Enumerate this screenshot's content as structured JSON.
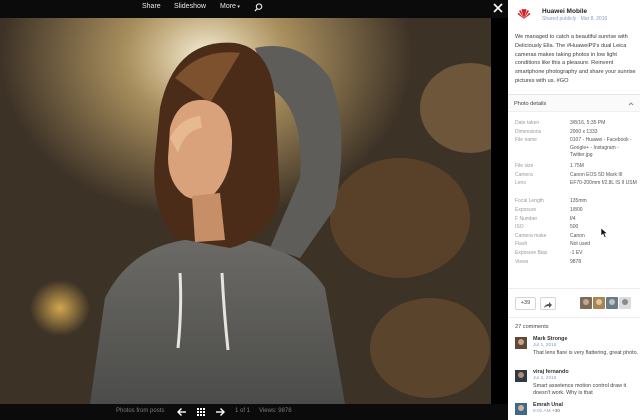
{
  "viewer": {
    "top_nav": [
      {
        "label": "Share"
      },
      {
        "label": "Slideshow"
      },
      {
        "label": "More"
      }
    ],
    "bottom": {
      "photos_from_posts": "Photos from posts",
      "page_indicator": "1 of 1",
      "views": "Views: 9878"
    }
  },
  "panel": {
    "author": "Huawei Mobile",
    "share_meta": "Shared publicly · Mar 8, 2016",
    "post_text": "We managed to catch a beautiful sunrise with Deliciously Ella. The #HuaweiP9's dual Leica cameras makes taking photos in low light conditions like this a pleasure. Reinvent smartphone photography and share your sunrise pictures with us. #GO",
    "details_title": "Photo details",
    "details": [
      {
        "label": "Date taken",
        "value": "3/8/16, 5:35 PM"
      },
      {
        "label": "Dimensions",
        "value": "2000 x 1333"
      },
      {
        "label": "File name",
        "value": "0107 - Huawei - Facebook - Google+ - Instagram - Twitter.jpg"
      },
      {
        "label": "File size",
        "value": "1.75M"
      },
      {
        "label": "Camera",
        "value": "Canon EOS 5D Mark III"
      },
      {
        "label": "Lens",
        "value": "EF70-200mm f/2.8L IS II USM"
      },
      {
        "label": "Focal Length",
        "value": "135mm"
      },
      {
        "label": "Exposure",
        "value": "1/800"
      },
      {
        "label": "F Number",
        "value": "f/4"
      },
      {
        "label": "ISO",
        "value": "500"
      },
      {
        "label": "Camera make",
        "value": "Canon"
      },
      {
        "label": "Flash",
        "value": "Not used"
      },
      {
        "label": "Exposure Bias",
        "value": "-1 EV"
      },
      {
        "label": "Views",
        "value": "9878"
      }
    ],
    "plus_count": "+39",
    "comments_count": "27 comments",
    "comments": [
      {
        "name": "Mark Stronge",
        "date": "Jul 1, 2016",
        "text": "That lens flare is very flattering, great photo."
      },
      {
        "name": "viraj fernando",
        "date": "Jul 2, 2016",
        "text": "Smart assetence motion control draw it doesn't work. Why is that"
      },
      {
        "name": "Emrah Unal",
        "date": "8:02 AM",
        "plus": "+30"
      }
    ]
  },
  "colors": {
    "panel_bg": "#ffffff",
    "viewer_bg": "#000000",
    "link_blue": "#8aa0c8",
    "huawei_red": "#d21f26"
  }
}
